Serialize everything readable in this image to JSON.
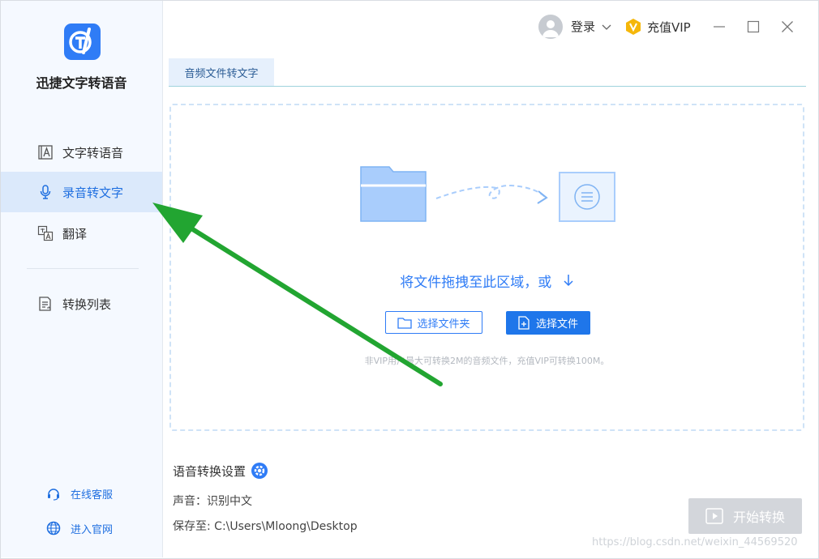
{
  "app": {
    "title": "迅捷文字转语音"
  },
  "sidebar": {
    "items": [
      {
        "label": "文字转语音",
        "icon": "text-to-speech-icon"
      },
      {
        "label": "录音转文字",
        "icon": "microphone-icon",
        "active": true
      },
      {
        "label": "翻译",
        "icon": "translate-icon"
      },
      {
        "label": "转换列表",
        "icon": "list-icon"
      }
    ],
    "bottom": [
      {
        "label": "在线客服",
        "icon": "headset-icon"
      },
      {
        "label": "进入官网",
        "icon": "globe-icon"
      }
    ]
  },
  "header": {
    "login": "登录",
    "vip": "充值VIP"
  },
  "tabs": [
    {
      "label": "音频文件转文字"
    }
  ],
  "dropzone": {
    "text": "将文件拖拽至此区域，或",
    "select_folder": "选择文件夹",
    "select_file": "选择文件",
    "hint": "非VIP用户最大可转换2M的音频文件，充值VIP可转换100M。"
  },
  "settings": {
    "title": "语音转换设置",
    "voice_label": "声音：识别中文",
    "save_label": "保存至: C:\\Users\\Mloong\\Desktop",
    "start": "开始转换"
  },
  "watermark": "https://blog.csdn.net/weixin_44569520",
  "colors": {
    "accent": "#2f7cf6",
    "active_bg": "#dbe9fb",
    "sidebar_bg": "#f5f9ff",
    "annotation_arrow": "#22a531"
  }
}
